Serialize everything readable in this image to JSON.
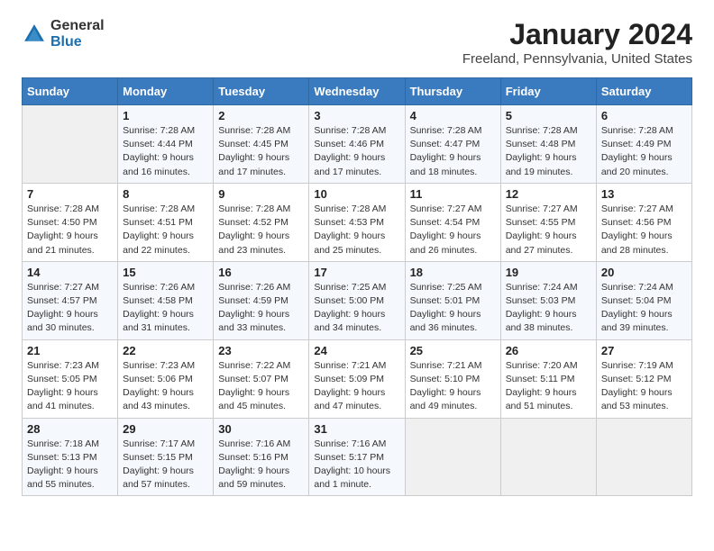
{
  "header": {
    "logo_general": "General",
    "logo_blue": "Blue",
    "month_title": "January 2024",
    "location": "Freeland, Pennsylvania, United States"
  },
  "days_of_week": [
    "Sunday",
    "Monday",
    "Tuesday",
    "Wednesday",
    "Thursday",
    "Friday",
    "Saturday"
  ],
  "weeks": [
    [
      {
        "day": "",
        "sunrise": "",
        "sunset": "",
        "daylight": ""
      },
      {
        "day": "1",
        "sunrise": "Sunrise: 7:28 AM",
        "sunset": "Sunset: 4:44 PM",
        "daylight": "Daylight: 9 hours and 16 minutes."
      },
      {
        "day": "2",
        "sunrise": "Sunrise: 7:28 AM",
        "sunset": "Sunset: 4:45 PM",
        "daylight": "Daylight: 9 hours and 17 minutes."
      },
      {
        "day": "3",
        "sunrise": "Sunrise: 7:28 AM",
        "sunset": "Sunset: 4:46 PM",
        "daylight": "Daylight: 9 hours and 17 minutes."
      },
      {
        "day": "4",
        "sunrise": "Sunrise: 7:28 AM",
        "sunset": "Sunset: 4:47 PM",
        "daylight": "Daylight: 9 hours and 18 minutes."
      },
      {
        "day": "5",
        "sunrise": "Sunrise: 7:28 AM",
        "sunset": "Sunset: 4:48 PM",
        "daylight": "Daylight: 9 hours and 19 minutes."
      },
      {
        "day": "6",
        "sunrise": "Sunrise: 7:28 AM",
        "sunset": "Sunset: 4:49 PM",
        "daylight": "Daylight: 9 hours and 20 minutes."
      }
    ],
    [
      {
        "day": "7",
        "sunrise": "Sunrise: 7:28 AM",
        "sunset": "Sunset: 4:50 PM",
        "daylight": "Daylight: 9 hours and 21 minutes."
      },
      {
        "day": "8",
        "sunrise": "Sunrise: 7:28 AM",
        "sunset": "Sunset: 4:51 PM",
        "daylight": "Daylight: 9 hours and 22 minutes."
      },
      {
        "day": "9",
        "sunrise": "Sunrise: 7:28 AM",
        "sunset": "Sunset: 4:52 PM",
        "daylight": "Daylight: 9 hours and 23 minutes."
      },
      {
        "day": "10",
        "sunrise": "Sunrise: 7:28 AM",
        "sunset": "Sunset: 4:53 PM",
        "daylight": "Daylight: 9 hours and 25 minutes."
      },
      {
        "day": "11",
        "sunrise": "Sunrise: 7:27 AM",
        "sunset": "Sunset: 4:54 PM",
        "daylight": "Daylight: 9 hours and 26 minutes."
      },
      {
        "day": "12",
        "sunrise": "Sunrise: 7:27 AM",
        "sunset": "Sunset: 4:55 PM",
        "daylight": "Daylight: 9 hours and 27 minutes."
      },
      {
        "day": "13",
        "sunrise": "Sunrise: 7:27 AM",
        "sunset": "Sunset: 4:56 PM",
        "daylight": "Daylight: 9 hours and 28 minutes."
      }
    ],
    [
      {
        "day": "14",
        "sunrise": "Sunrise: 7:27 AM",
        "sunset": "Sunset: 4:57 PM",
        "daylight": "Daylight: 9 hours and 30 minutes."
      },
      {
        "day": "15",
        "sunrise": "Sunrise: 7:26 AM",
        "sunset": "Sunset: 4:58 PM",
        "daylight": "Daylight: 9 hours and 31 minutes."
      },
      {
        "day": "16",
        "sunrise": "Sunrise: 7:26 AM",
        "sunset": "Sunset: 4:59 PM",
        "daylight": "Daylight: 9 hours and 33 minutes."
      },
      {
        "day": "17",
        "sunrise": "Sunrise: 7:25 AM",
        "sunset": "Sunset: 5:00 PM",
        "daylight": "Daylight: 9 hours and 34 minutes."
      },
      {
        "day": "18",
        "sunrise": "Sunrise: 7:25 AM",
        "sunset": "Sunset: 5:01 PM",
        "daylight": "Daylight: 9 hours and 36 minutes."
      },
      {
        "day": "19",
        "sunrise": "Sunrise: 7:24 AM",
        "sunset": "Sunset: 5:03 PM",
        "daylight": "Daylight: 9 hours and 38 minutes."
      },
      {
        "day": "20",
        "sunrise": "Sunrise: 7:24 AM",
        "sunset": "Sunset: 5:04 PM",
        "daylight": "Daylight: 9 hours and 39 minutes."
      }
    ],
    [
      {
        "day": "21",
        "sunrise": "Sunrise: 7:23 AM",
        "sunset": "Sunset: 5:05 PM",
        "daylight": "Daylight: 9 hours and 41 minutes."
      },
      {
        "day": "22",
        "sunrise": "Sunrise: 7:23 AM",
        "sunset": "Sunset: 5:06 PM",
        "daylight": "Daylight: 9 hours and 43 minutes."
      },
      {
        "day": "23",
        "sunrise": "Sunrise: 7:22 AM",
        "sunset": "Sunset: 5:07 PM",
        "daylight": "Daylight: 9 hours and 45 minutes."
      },
      {
        "day": "24",
        "sunrise": "Sunrise: 7:21 AM",
        "sunset": "Sunset: 5:09 PM",
        "daylight": "Daylight: 9 hours and 47 minutes."
      },
      {
        "day": "25",
        "sunrise": "Sunrise: 7:21 AM",
        "sunset": "Sunset: 5:10 PM",
        "daylight": "Daylight: 9 hours and 49 minutes."
      },
      {
        "day": "26",
        "sunrise": "Sunrise: 7:20 AM",
        "sunset": "Sunset: 5:11 PM",
        "daylight": "Daylight: 9 hours and 51 minutes."
      },
      {
        "day": "27",
        "sunrise": "Sunrise: 7:19 AM",
        "sunset": "Sunset: 5:12 PM",
        "daylight": "Daylight: 9 hours and 53 minutes."
      }
    ],
    [
      {
        "day": "28",
        "sunrise": "Sunrise: 7:18 AM",
        "sunset": "Sunset: 5:13 PM",
        "daylight": "Daylight: 9 hours and 55 minutes."
      },
      {
        "day": "29",
        "sunrise": "Sunrise: 7:17 AM",
        "sunset": "Sunset: 5:15 PM",
        "daylight": "Daylight: 9 hours and 57 minutes."
      },
      {
        "day": "30",
        "sunrise": "Sunrise: 7:16 AM",
        "sunset": "Sunset: 5:16 PM",
        "daylight": "Daylight: 9 hours and 59 minutes."
      },
      {
        "day": "31",
        "sunrise": "Sunrise: 7:16 AM",
        "sunset": "Sunset: 5:17 PM",
        "daylight": "Daylight: 10 hours and 1 minute."
      },
      {
        "day": "",
        "sunrise": "",
        "sunset": "",
        "daylight": ""
      },
      {
        "day": "",
        "sunrise": "",
        "sunset": "",
        "daylight": ""
      },
      {
        "day": "",
        "sunrise": "",
        "sunset": "",
        "daylight": ""
      }
    ]
  ]
}
